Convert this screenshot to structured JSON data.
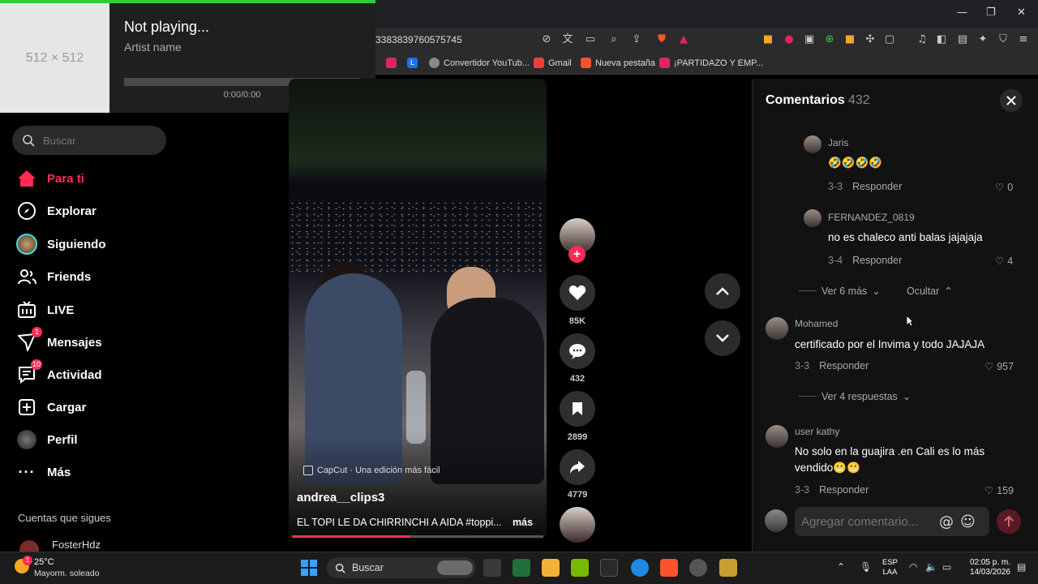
{
  "browser": {
    "url_fragment": "3383839760575745",
    "bookmarks": [
      {
        "label": "",
        "color": "#e0245e"
      },
      {
        "label": "L",
        "color": "#1a73e8"
      },
      {
        "label": "Convertidor YouTub...",
        "color": "#888888"
      },
      {
        "label": "Gmail",
        "color": "#ea4335"
      },
      {
        "label": "Nueva pestaña",
        "color": "#fb542b"
      },
      {
        "label": "¡PARTIDAZO Y EMP...",
        "color": "#e0245e"
      }
    ],
    "window_controls": {
      "minimize": "—",
      "maximize": "❐",
      "close": "✕"
    }
  },
  "media": {
    "placeholder": "512 × 512",
    "title": "Not playing...",
    "artist": "Artist name",
    "time": "0:00/0:00",
    "progress_fraction": 0
  },
  "sidebar": {
    "search_placeholder": "Buscar",
    "items": [
      {
        "label": "Para ti",
        "icon": "home-icon",
        "active": true,
        "badge": ""
      },
      {
        "label": "Explorar",
        "icon": "compass-icon",
        "active": false,
        "badge": ""
      },
      {
        "label": "Siguiendo",
        "icon": "following-avatar-icon",
        "active": false,
        "badge": ""
      },
      {
        "label": "Friends",
        "icon": "friends-icon",
        "active": false,
        "badge": ""
      },
      {
        "label": "LIVE",
        "icon": "live-icon",
        "active": false,
        "badge": ""
      },
      {
        "label": "Mensajes",
        "icon": "messages-icon",
        "active": false,
        "badge": "1"
      },
      {
        "label": "Actividad",
        "icon": "activity-icon",
        "active": false,
        "badge": "10"
      },
      {
        "label": "Cargar",
        "icon": "upload-icon",
        "active": false,
        "badge": ""
      },
      {
        "label": "Perfil",
        "icon": "profile-avatar-icon",
        "active": false,
        "badge": ""
      },
      {
        "label": "Más",
        "icon": "more-icon",
        "active": false,
        "badge": ""
      }
    ],
    "following_heading": "Cuentas que sigues",
    "following": [
      {
        "name": "FosterHdz"
      }
    ]
  },
  "video": {
    "capcut_label": "CapCut · Una edición más fácil",
    "author": "andrea__clips3",
    "caption": "EL TOPI LE DA CHIRRINCHI A AIDA #toppi...",
    "more_label": "más",
    "progress_fraction": 0.47
  },
  "actions": {
    "likes": "85K",
    "comments": "432",
    "saves": "2899",
    "shares": "4779"
  },
  "comments": {
    "title": "Comentarios",
    "count": "432",
    "reply_label": "Responder",
    "input_placeholder": "Agregar comentario...",
    "items": [
      {
        "user": "Jaris",
        "text": "🤣🤣🤣🤣",
        "date": "3-3",
        "likes": "0",
        "is_reply": true
      },
      {
        "user": "FERNANDEZ_0819",
        "text": "no es chaleco anti balas jajajaja",
        "date": "3-4",
        "likes": "4",
        "is_reply": true
      },
      {
        "user": "Mohamed",
        "text": "certificado por el Invima y todo JAJAJA",
        "date": "3-3",
        "likes": "957",
        "is_reply": false
      },
      {
        "user": "user kathy",
        "text": "No solo en la guajira .en Cali es lo más vendido😬😬",
        "date": "3-3",
        "likes": "159",
        "is_reply": false
      }
    ],
    "view_more_1": "Ver 6 más",
    "hide_label": "Ocultar",
    "view_more_2": "Ver 4 respuestas"
  },
  "taskbar": {
    "weather_temp": "25°C",
    "weather_desc": "Mayorm. soleado",
    "weather_badge": "1",
    "search_label": "Buscar",
    "lang_line1": "ESP",
    "lang_line2": "LAA",
    "time": "02:05 p. m.",
    "date": "14/03/2026"
  },
  "colors": {
    "accent": "#fe2c55",
    "media_progress": "#2ecc40"
  }
}
